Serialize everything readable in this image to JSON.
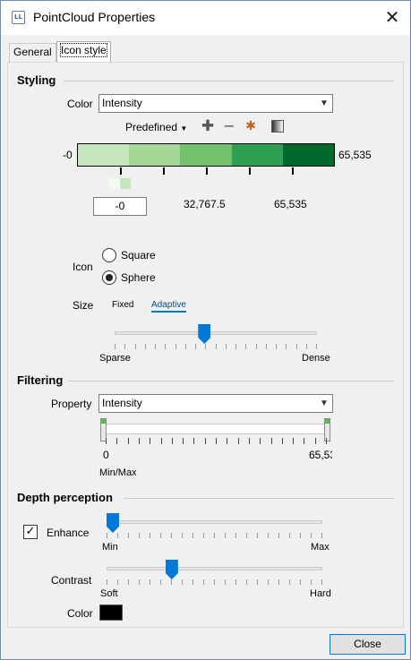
{
  "window": {
    "title": "PointCloud Properties",
    "icon_text": "LL"
  },
  "tabs": [
    {
      "label": "General"
    },
    {
      "label": "Icon style"
    }
  ],
  "styling": {
    "title": "Styling",
    "color_label": "Color",
    "color_value": "Intensity",
    "predefined_label": "Predefined",
    "colorbar": {
      "min_label": "-0",
      "max_label": "65,535",
      "colors": [
        "#c6e6c0",
        "#a4d897",
        "#73c26d",
        "#2fa052",
        "#006a2c"
      ],
      "selected_swatch_color": "#c6e6c0"
    },
    "stop_input_value": "-0",
    "mid_value": "32,767.5",
    "max_value": "65,535",
    "icon_label": "Icon",
    "icon_options": [
      {
        "label": "Square",
        "selected": false
      },
      {
        "label": "Sphere",
        "selected": true
      }
    ],
    "size_label": "Size",
    "size_modes": [
      {
        "label": "Fixed",
        "active": false
      },
      {
        "label": "Adaptive",
        "active": true
      }
    ],
    "size_slider": {
      "min_label": "Sparse",
      "max_label": "Dense",
      "value_fraction": 0.44
    }
  },
  "filtering": {
    "title": "Filtering",
    "property_label": "Property",
    "property_value": "Intensity",
    "range_min": "0",
    "range_max": "65,53",
    "range_caption": "Min/Max"
  },
  "depth": {
    "title": "Depth perception",
    "enhance_label": "Enhance",
    "enhance_checked": true,
    "enhance_slider": {
      "min_label": "Min",
      "max_label": "Max",
      "value_fraction": 0.0
    },
    "contrast_label": "Contrast",
    "contrast_slider": {
      "min_label": "Soft",
      "max_label": "Hard",
      "value_fraction": 0.29
    },
    "color_label": "Color",
    "color_value": "#000000"
  },
  "footer": {
    "close_label": "Close"
  },
  "colors": {
    "accent": "#0078d7",
    "range_handle_mark": "#5cb85c"
  }
}
